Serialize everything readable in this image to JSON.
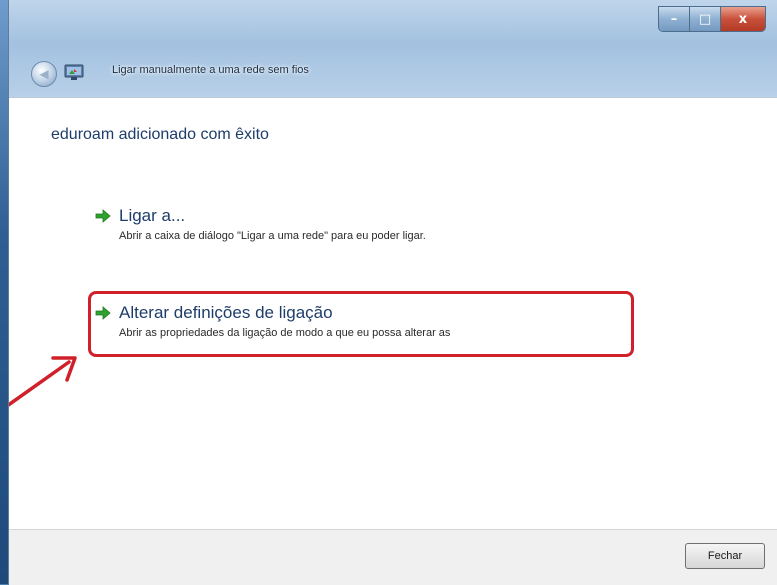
{
  "window": {
    "title": "Ligar manualmente a uma rede sem fios",
    "minimize_glyph": "–",
    "maximize_glyph": "□",
    "close_glyph": "x"
  },
  "content": {
    "heading": "eduroam adicionado com êxito",
    "options": [
      {
        "title": "Ligar a...",
        "description": "Abrir a caixa de diálogo \"Ligar a uma rede\" para eu poder ligar.",
        "icon": "green-arrow-icon"
      },
      {
        "title": "Alterar definições de ligação",
        "description": "Abrir as propriedades da ligação de modo a que eu possa alterar as",
        "icon": "green-arrow-icon"
      }
    ]
  },
  "footer": {
    "close_label": "Fechar"
  },
  "colors": {
    "accent_text": "#1e3d6a",
    "highlight": "#d0202a",
    "arrow_green": "#2fa12f"
  }
}
